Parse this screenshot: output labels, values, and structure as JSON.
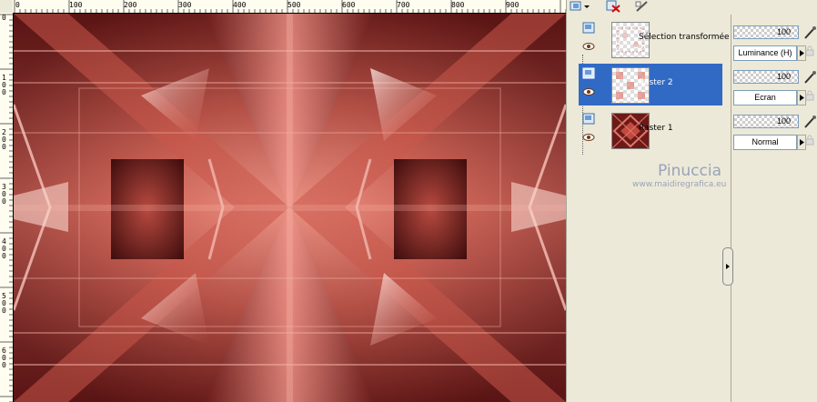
{
  "rulers": {
    "horizontal": [
      "0",
      "100",
      "200",
      "300",
      "400",
      "500",
      "600",
      "700",
      "800",
      "900"
    ],
    "vertical": [
      "0",
      "100",
      "200",
      "300",
      "400",
      "500",
      "600"
    ]
  },
  "canvas": {
    "description_color": "#d66a5c",
    "dark": "#5a1414",
    "light": "#f2a396"
  },
  "palette_toolbar": {
    "icons": [
      "layer-type-icon",
      "delete-layer-icon",
      "brush-tool-icon"
    ]
  },
  "layers": [
    {
      "name": "Sélection transformée",
      "selected": false,
      "opacity": "100",
      "blend": "Luminance (H)"
    },
    {
      "name": "Raster 2",
      "selected": true,
      "opacity": "100",
      "blend": "Ecran"
    },
    {
      "name": "Raster 1",
      "selected": false,
      "opacity": "100",
      "blend": "Normal"
    }
  ],
  "watermark": {
    "name": "Pinuccia",
    "url": "www.maidiregrafica.eu"
  },
  "colors": {
    "selection": "#316ac5",
    "panel": "#ece9d8",
    "border": "#7f9db9"
  }
}
